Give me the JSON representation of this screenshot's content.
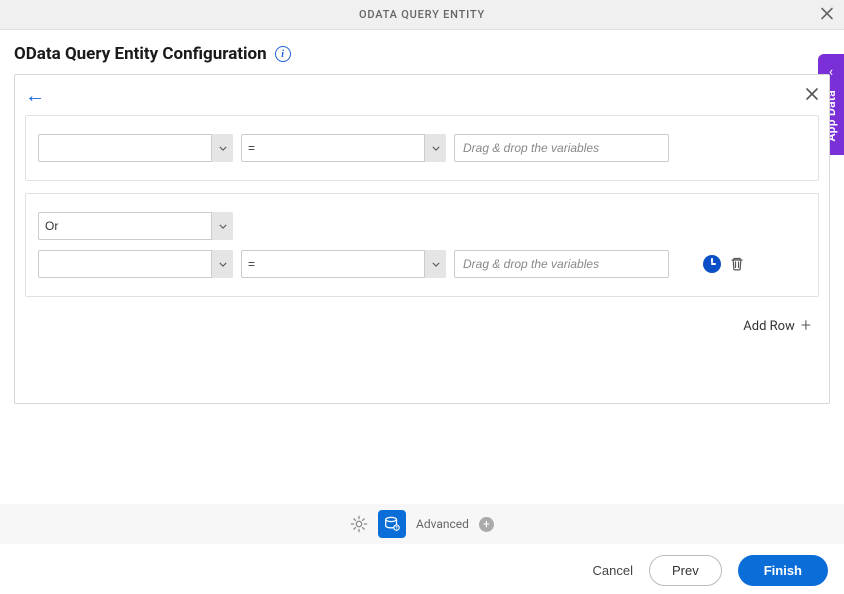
{
  "dialog": {
    "title": "ODATA QUERY ENTITY"
  },
  "page": {
    "heading": "OData Query Entity Configuration"
  },
  "builder": {
    "rows": [
      {
        "field": "",
        "operator": "=",
        "valuePlaceholder": "Drag & drop the variables"
      }
    ],
    "group2": {
      "logic": "Or",
      "rows": [
        {
          "field": "",
          "operator": "=",
          "valuePlaceholder": "Drag & drop the variables"
        }
      ]
    },
    "addRowLabel": "Add Row"
  },
  "sideTab": {
    "label": "App Data"
  },
  "toolbar": {
    "advancedLabel": "Advanced"
  },
  "footer": {
    "cancel": "Cancel",
    "prev": "Prev",
    "finish": "Finish"
  }
}
